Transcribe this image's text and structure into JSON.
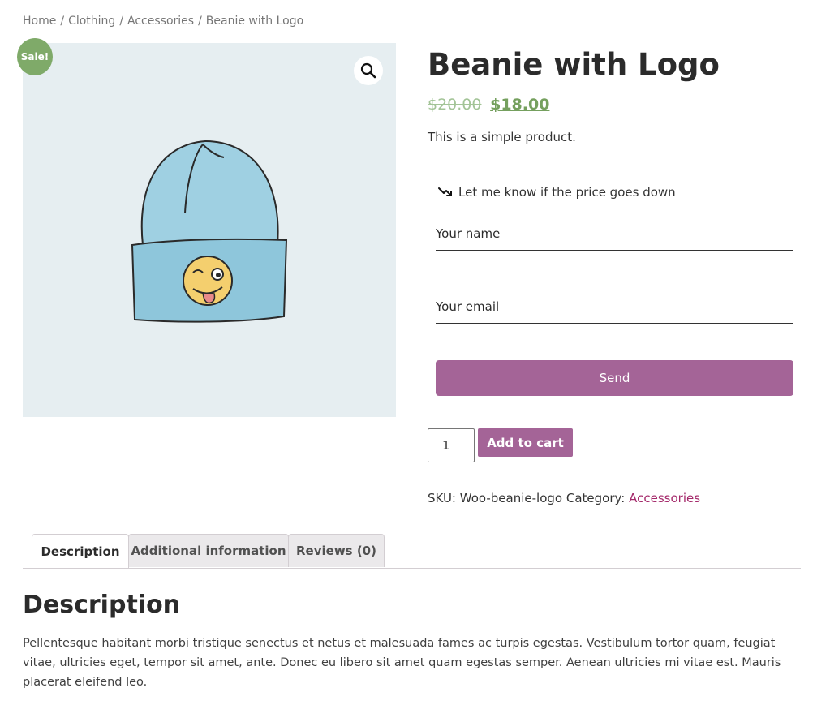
{
  "breadcrumb": {
    "items": [
      "Home",
      "Clothing",
      "Accessories"
    ],
    "separator": "/",
    "current": "Beanie with Logo"
  },
  "gallery": {
    "sale_badge": "Sale!",
    "zoom_icon": "magnifier-icon",
    "image_subject": "beanie",
    "colors": {
      "background": "#e6eef1",
      "beanie": "#9fd0e2",
      "badge": "#7faa69"
    }
  },
  "product": {
    "title": "Beanie with Logo",
    "price_old": "$20.00",
    "price_new": "$18.00",
    "short_description": "This is a simple product."
  },
  "price_alert": {
    "icon": "trending-down-icon",
    "heading": "Let me know if the price goes down",
    "name_placeholder": "Your name",
    "email_placeholder": "Your email",
    "send_label": "Send"
  },
  "cart": {
    "quantity": "1",
    "add_label": "Add to cart",
    "accent": "#a46497"
  },
  "meta": {
    "sku_label": "SKU:",
    "sku": "Woo-beanie-logo",
    "category_label": "Category:",
    "category": "Accessories"
  },
  "tabs": [
    {
      "label": "Description",
      "active": true
    },
    {
      "label": "Additional information",
      "active": false
    },
    {
      "label": "Reviews (0)",
      "active": false
    }
  ],
  "description": {
    "heading": "Description",
    "text": "Pellentesque habitant morbi tristique senectus et netus et malesuada fames ac turpis egestas. Vestibulum tortor quam, feugiat vitae, ultricies eget, tempor sit amet, ante. Donec eu libero sit amet quam egestas semper. Aenean ultricies mi vitae est. Mauris placerat eleifend leo."
  }
}
